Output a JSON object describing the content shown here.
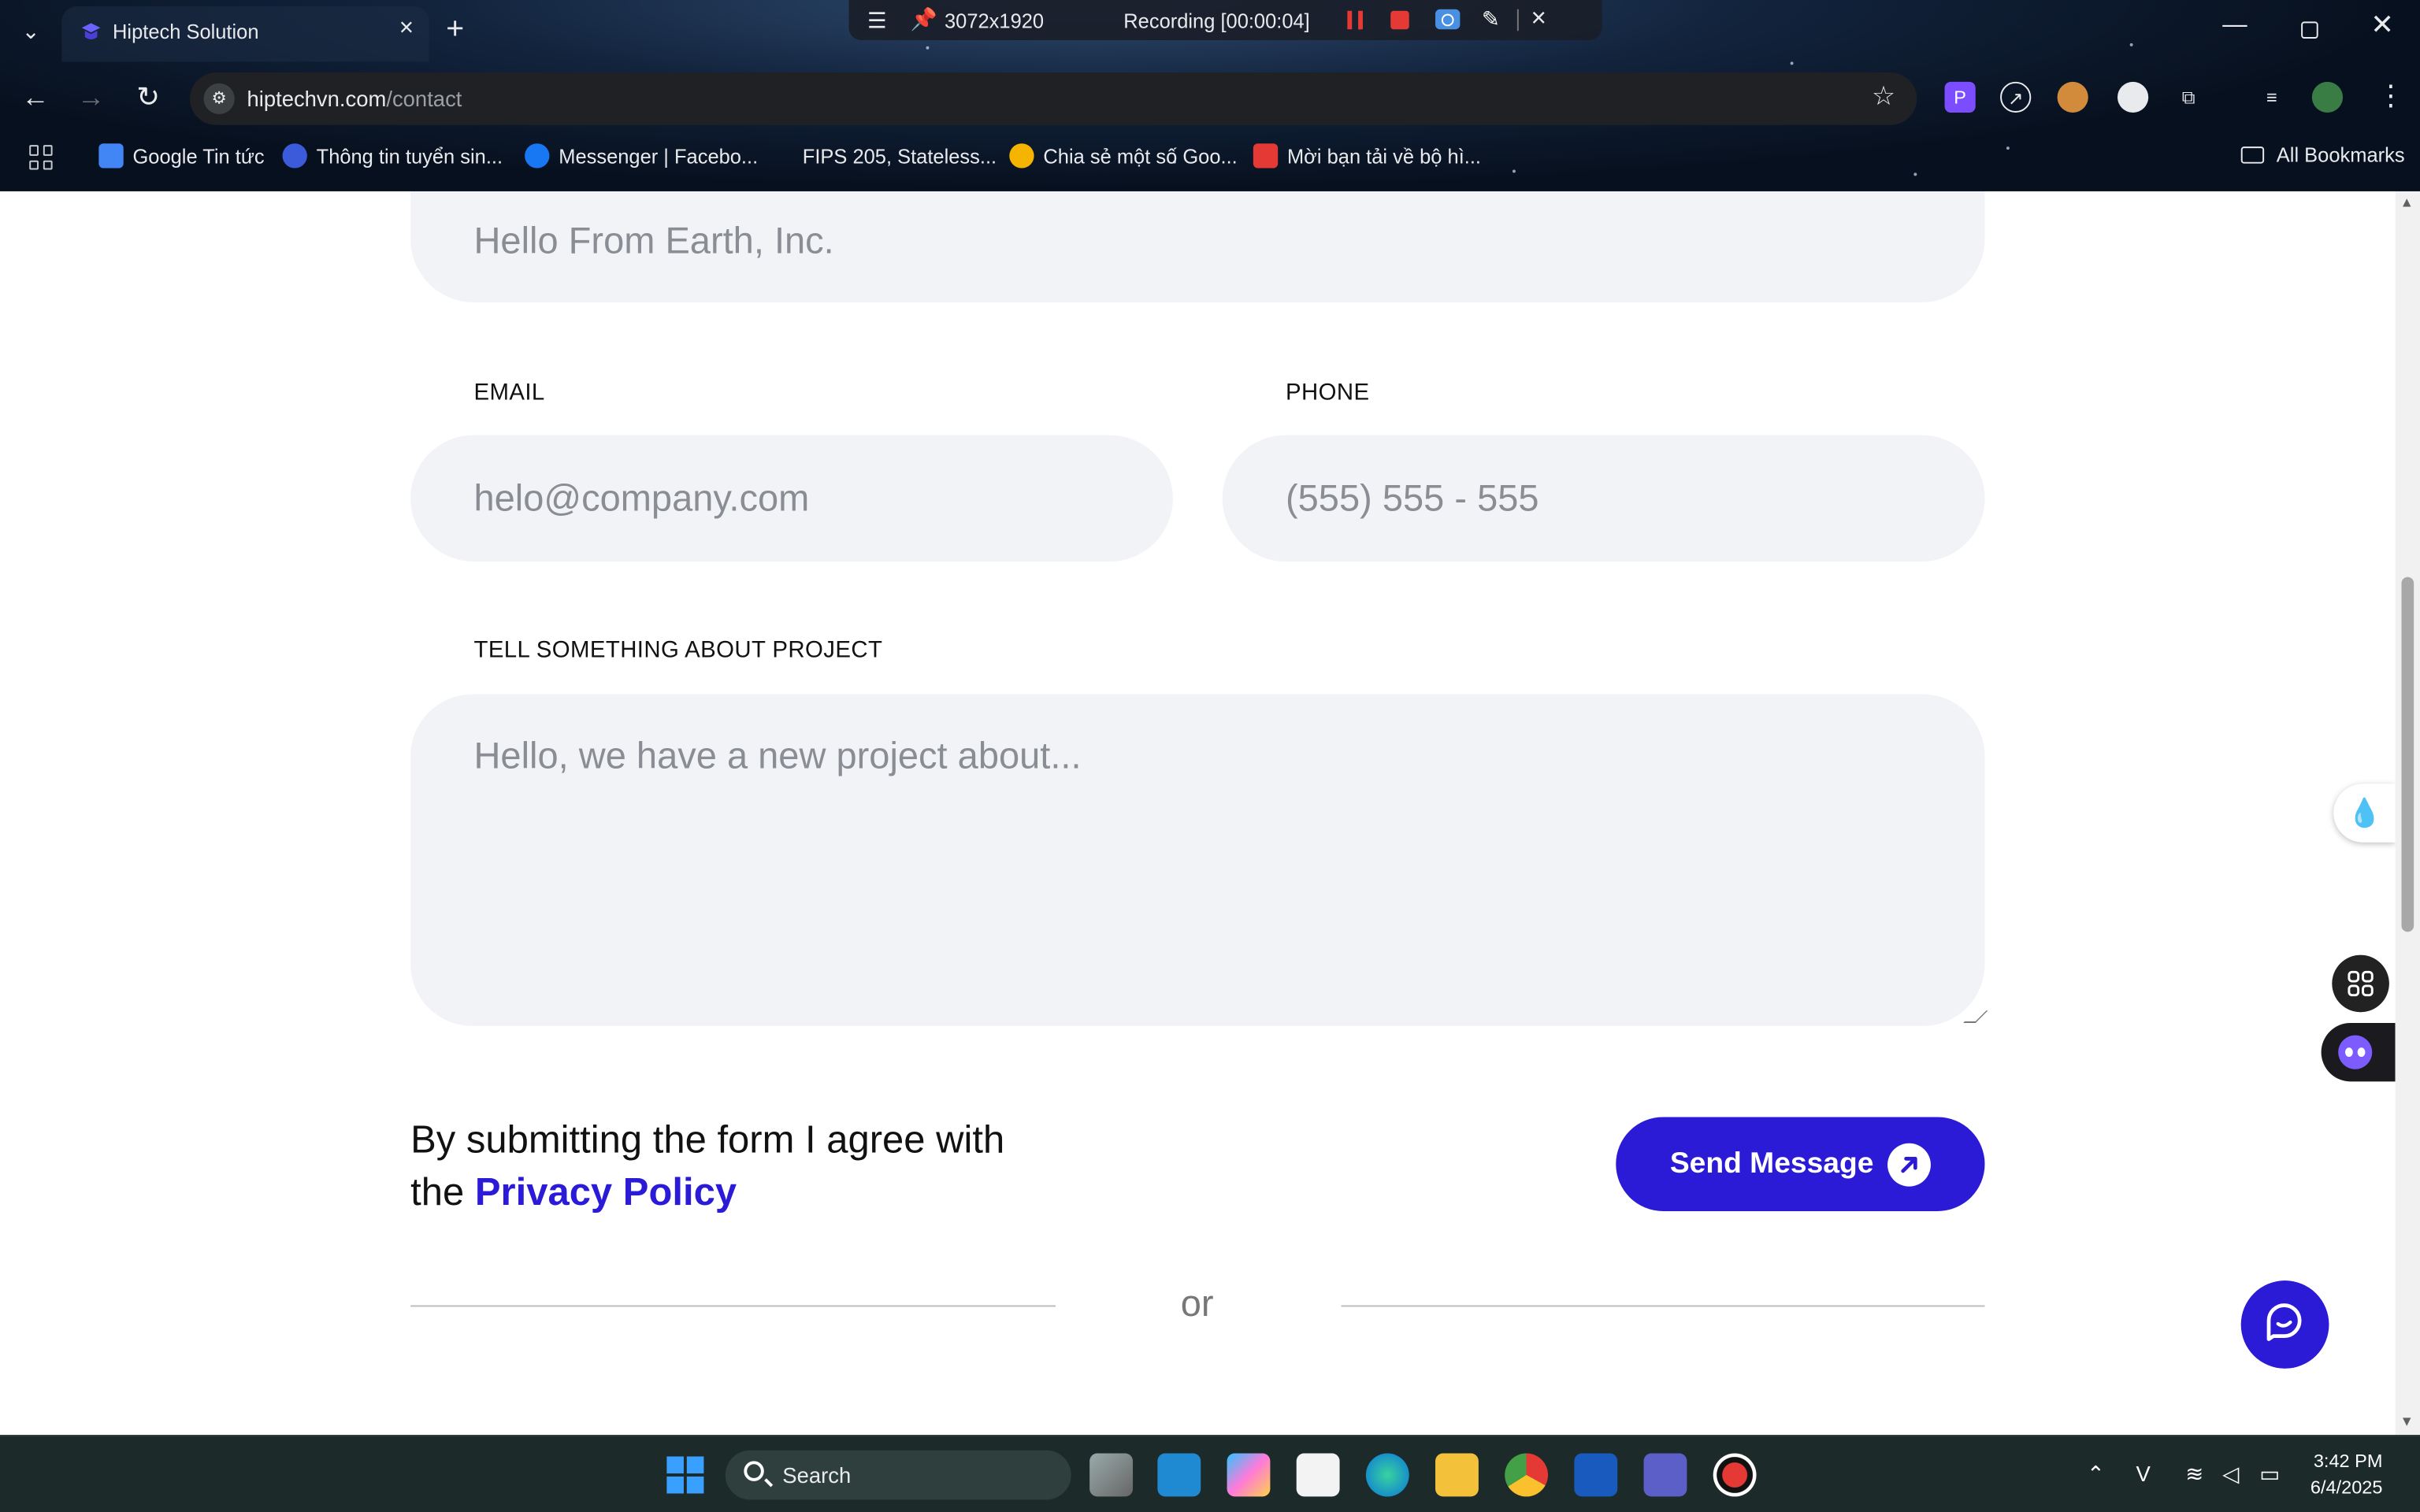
{
  "browser": {
    "tab_title": "Hiptech Solution",
    "url_domain": "hiptechvn.com",
    "url_path": "/contact",
    "bookmarks": [
      "Google Tin tức",
      "Thông tin tuyển sin...",
      "Messenger | Facebo...",
      "FIPS 205, Stateless...",
      "Chia sẻ một số Goo...",
      "Mời bạn tải về bộ hì..."
    ],
    "all_bookmarks": "All Bookmarks"
  },
  "recorder": {
    "size": "3072x1920",
    "status": "Recording [00:00:04]"
  },
  "form": {
    "company_value": "Hello From Earth, Inc.",
    "email_label": "EMAIL",
    "email_placeholder": "helo@company.com",
    "phone_label": "PHONE",
    "phone_placeholder": "(555) 555 - 555",
    "project_label": "TELL SOMETHING ABOUT PROJECT",
    "project_placeholder": "Hello, we have a new project about...",
    "agree_line1": "By submitting the form I agree with",
    "agree_the": "the",
    "privacy_link": "Privacy Policy",
    "send_label": "Send Message",
    "or_text": "or"
  },
  "taskbar": {
    "search_label": "Search",
    "time": "3:42 PM",
    "date": "6/4/2025"
  },
  "colors": {
    "accent": "#2b1bd6",
    "field_bg": "#f2f3f7",
    "placeholder": "#8a8d94"
  }
}
